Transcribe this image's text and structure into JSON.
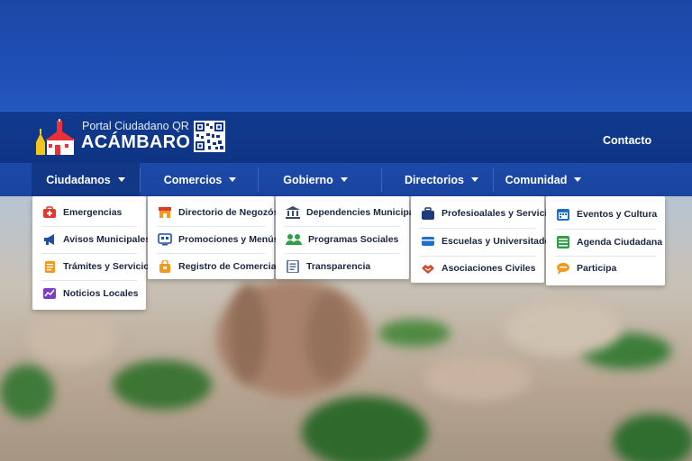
{
  "header": {
    "subtitle": "Portal Ciudadano QR",
    "title": "ACÁMBARO",
    "contact": "Contacto"
  },
  "nav": [
    {
      "label": "Ciudadanos",
      "active": true
    },
    {
      "label": "Comercios"
    },
    {
      "label": "Gobierno"
    },
    {
      "label": "Directorios"
    },
    {
      "label": "Comunidad"
    }
  ],
  "menus": {
    "ciudadanos": [
      "Emergencias",
      "Avisos Municipales",
      "Trámites y Servicios",
      "Noticios Locales"
    ],
    "comercios": [
      "Directorio de Negozós",
      "Promociones y Menús QR",
      "Registro de Comercia"
    ],
    "gobierno": [
      "Dependencies Municipales",
      "Programas Sociales",
      "Transparencia"
    ],
    "directorios": [
      "Profesioalales y Servicios",
      "Escuelas y Universitados",
      "Asociaciones Civiles"
    ],
    "comunidad": [
      "Eventos y Cultura",
      "Agenda Ciudadana",
      "Participa"
    ]
  },
  "colors": {
    "header_bg": "#0f3484",
    "nav_bg": "#1c4aa8",
    "nav_active": "#123787",
    "icon_red": "#e03b2a",
    "icon_blue": "#1d4ea8",
    "icon_orange": "#f39a1e",
    "icon_purple": "#7b3fc4",
    "icon_green": "#2f9e44"
  }
}
